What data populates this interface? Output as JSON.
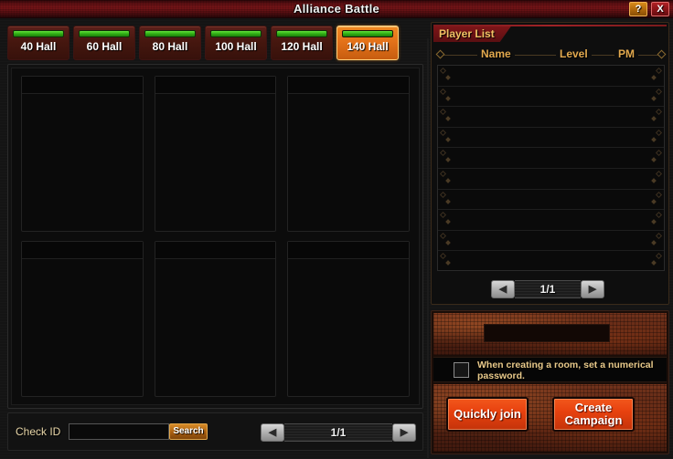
{
  "window": {
    "title": "Alliance Battle",
    "help_label": "?",
    "close_label": "X"
  },
  "tabs": [
    {
      "label": "40 Hall",
      "active": false
    },
    {
      "label": "60 Hall",
      "active": false
    },
    {
      "label": "80 Hall",
      "active": false
    },
    {
      "label": "100 Hall",
      "active": false
    },
    {
      "label": "120 Hall",
      "active": false
    },
    {
      "label": "140 Hall",
      "active": true
    }
  ],
  "rooms": {
    "cards": [
      "",
      "",
      "",
      "",
      "",
      ""
    ],
    "pager": {
      "prev": "◀",
      "value": "1/1",
      "next": "▶"
    }
  },
  "search": {
    "label": "Check ID",
    "value": "",
    "placeholder": "",
    "button": "Search"
  },
  "player_list": {
    "title": "Player List",
    "columns": {
      "name": "Name",
      "level": "Level",
      "pm": "PM"
    },
    "rows": [
      "",
      "",
      "",
      "",
      "",
      "",
      "",
      "",
      "",
      ""
    ],
    "pager": {
      "prev": "◀",
      "value": "1/1",
      "next": "▶"
    }
  },
  "create": {
    "password_value": "",
    "password_placeholder": "",
    "note": "When creating a room, set a numerical password.",
    "quick_join": "Quickly join",
    "create_campaign": "Create Campaign"
  },
  "colors": {
    "title_red": "#7a1518",
    "accent_orange": "#e4721a",
    "button_red": "#e8420f",
    "gold_text": "#e2a94e",
    "bar_green": "#2fae15"
  }
}
